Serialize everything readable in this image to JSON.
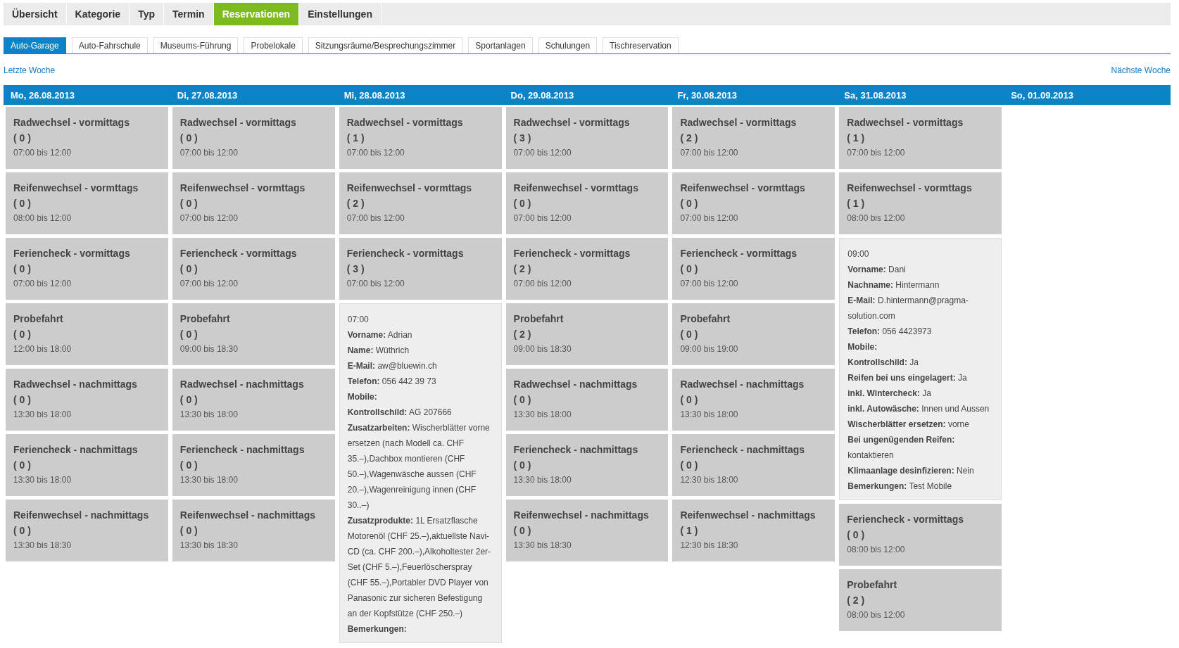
{
  "main_nav": [
    {
      "label": "Übersicht",
      "selected": false
    },
    {
      "label": "Kategorie",
      "selected": false
    },
    {
      "label": "Typ",
      "selected": false
    },
    {
      "label": "Termin",
      "selected": false
    },
    {
      "label": "Reservationen",
      "selected": true
    },
    {
      "label": "Einstellungen",
      "selected": false
    }
  ],
  "sub_tabs": [
    {
      "label": "Auto-Garage",
      "selected": true
    },
    {
      "label": "Auto-Fahrschule",
      "selected": false
    },
    {
      "label": "Museums-Führung",
      "selected": false
    },
    {
      "label": "Probelokale",
      "selected": false
    },
    {
      "label": "Sitzungsräume/Besprechungszimmer",
      "selected": false
    },
    {
      "label": "Sportanlagen",
      "selected": false
    },
    {
      "label": "Schulungen",
      "selected": false
    },
    {
      "label": "Tischreservation",
      "selected": false
    }
  ],
  "week_nav": {
    "previous": "Letzte Woche",
    "next": "Nächste Woche"
  },
  "days": [
    {
      "date": "Mo, 26.08.2013",
      "entries": [
        {
          "kind": "slot",
          "title": "Radwechsel - vormittags",
          "count": "( 0 )",
          "time": "07:00 bis 12:00"
        },
        {
          "kind": "slot",
          "title": "Reifenwechsel - vormttags",
          "count": "( 0 )",
          "time": "08:00 bis 12:00"
        },
        {
          "kind": "slot",
          "title": "Feriencheck - vormittags",
          "count": "( 0 )",
          "time": "07:00 bis 12:00"
        },
        {
          "kind": "slot",
          "title": "Probefahrt",
          "count": "( 0 )",
          "time": "12:00 bis 18:00"
        },
        {
          "kind": "slot",
          "title": "Radwechsel - nachmittags",
          "count": "( 0 )",
          "time": "13:30 bis 18:00"
        },
        {
          "kind": "slot",
          "title": "Feriencheck - nachmittags",
          "count": "( 0 )",
          "time": "13:30 bis 18:00"
        },
        {
          "kind": "slot",
          "title": "Reifenwechsel - nachmittags",
          "count": "( 0 )",
          "time": "13:30 bis 18:30"
        }
      ]
    },
    {
      "date": "Di, 27.08.2013",
      "entries": [
        {
          "kind": "slot",
          "title": "Radwechsel - vormittags",
          "count": "( 0 )",
          "time": "07:00 bis 12:00"
        },
        {
          "kind": "slot",
          "title": "Reifenwechsel - vormttags",
          "count": "( 0 )",
          "time": "07:00 bis 12:00"
        },
        {
          "kind": "slot",
          "title": "Feriencheck - vormittags",
          "count": "( 0 )",
          "time": "07:00 bis 12:00"
        },
        {
          "kind": "slot",
          "title": "Probefahrt",
          "count": "( 0 )",
          "time": "09:00 bis 18:30"
        },
        {
          "kind": "slot",
          "title": "Radwechsel - nachmittags",
          "count": "( 0 )",
          "time": "13:30 bis 18:00"
        },
        {
          "kind": "slot",
          "title": "Feriencheck - nachmittags",
          "count": "( 0 )",
          "time": "13:30 bis 18:00"
        },
        {
          "kind": "slot",
          "title": "Reifenwechsel - nachmittags",
          "count": "( 0 )",
          "time": "13:30 bis 18:30"
        }
      ]
    },
    {
      "date": "Mi, 28.08.2013",
      "entries": [
        {
          "kind": "slot",
          "title": "Radwechsel - vormittags",
          "count": "( 1 )",
          "time": "07:00 bis 12:00"
        },
        {
          "kind": "slot",
          "title": "Reifenwechsel - vormttags",
          "count": "( 2 )",
          "time": "07:00 bis 12:00"
        },
        {
          "kind": "slot",
          "title": "Feriencheck - vormittags",
          "count": "( 3 )",
          "time": "07:00 bis 12:00"
        },
        {
          "kind": "detail",
          "time": "07:00",
          "fields": [
            {
              "label": "Vorname:",
              "value": "Adrian"
            },
            {
              "label": "Name:",
              "value": "Wüthrich"
            },
            {
              "label": "E-Mail:",
              "value": "aw@bluewin.ch"
            },
            {
              "label": "Telefon:",
              "value": "056 442 39 73"
            },
            {
              "label": "Mobile:"
            },
            {
              "label": "Kontrollschild:",
              "value": "AG 207666"
            },
            {
              "label": "Zusatzarbeiten:",
              "value": "Wischerblätter vorne ersetzen (nach Modell ca. CHF 35.–),Dachbox montieren (CHF 50.–),Wagenwäsche aussen (CHF 20.–),Wagenreinigung innen (CHF 30..–)"
            },
            {
              "label": "Zusatzprodukte:",
              "value": "1L Ersatzflasche Motorenöl (CHF 25.–),aktuellste Navi-CD (ca. CHF 200.–),Alkoholtester 2er-Set (CHF 5.–),Feuerlöscherspray (CHF 55.–),Portabler DVD Player von Panasonic zur sicheren Befestigung an der Kopfstütze (CHF 250.–)"
            },
            {
              "label": "Bemerkungen:"
            }
          ]
        }
      ]
    },
    {
      "date": "Do, 29.08.2013",
      "entries": [
        {
          "kind": "slot",
          "title": "Radwechsel - vormittags",
          "count": "( 3 )",
          "time": "07:00 bis 12:00"
        },
        {
          "kind": "slot",
          "title": "Reifenwechsel - vormttags",
          "count": "( 0 )",
          "time": "07:00 bis 12:00"
        },
        {
          "kind": "slot",
          "title": "Feriencheck - vormittags",
          "count": "( 2 )",
          "time": "07:00 bis 12:00"
        },
        {
          "kind": "slot",
          "title": "Probefahrt",
          "count": "( 2 )",
          "time": "09:00 bis 18:30"
        },
        {
          "kind": "slot",
          "title": "Radwechsel - nachmittags",
          "count": "( 0 )",
          "time": "13:30 bis 18:00"
        },
        {
          "kind": "slot",
          "title": "Feriencheck - nachmittags",
          "count": "( 0 )",
          "time": "13:30 bis 18:00"
        },
        {
          "kind": "slot",
          "title": "Reifenwechsel - nachmittags",
          "count": "( 0 )",
          "time": "13:30 bis 18:30"
        }
      ]
    },
    {
      "date": "Fr, 30.08.2013",
      "entries": [
        {
          "kind": "slot",
          "title": "Radwechsel - vormittags",
          "count": "( 2 )",
          "time": "07:00 bis 12:00"
        },
        {
          "kind": "slot",
          "title": "Reifenwechsel - vormttags",
          "count": "( 0 )",
          "time": "07:00 bis 12:00"
        },
        {
          "kind": "slot",
          "title": "Feriencheck - vormittags",
          "count": "( 0 )",
          "time": "07:00 bis 12:00"
        },
        {
          "kind": "slot",
          "title": "Probefahrt",
          "count": "( 0 )",
          "time": "09:00 bis 19:00"
        },
        {
          "kind": "slot",
          "title": "Radwechsel - nachmittags",
          "count": "( 0 )",
          "time": "13:30 bis 18:00"
        },
        {
          "kind": "slot",
          "title": "Feriencheck - nachmittags",
          "count": "( 0 )",
          "time": "12:30 bis 18:00"
        },
        {
          "kind": "slot",
          "title": "Reifenwechsel - nachmittags",
          "count": "( 1 )",
          "time": "12:30 bis 18:30"
        }
      ]
    },
    {
      "date": "Sa, 31.08.2013",
      "entries": [
        {
          "kind": "slot",
          "title": "Radwechsel - vormittags",
          "count": "( 1 )",
          "time": "07:00 bis 12:00"
        },
        {
          "kind": "slot",
          "title": "Reifenwechsel - vormttags",
          "count": "( 1 )",
          "time": "08:00 bis 12:00"
        },
        {
          "kind": "detail",
          "time": "09:00",
          "fields": [
            {
              "label": "Vorname:",
              "value": "Dani"
            },
            {
              "label": "Nachname:",
              "value": "Hintermann"
            },
            {
              "label": "E-Mail:",
              "value": "D.hintermann@pragma-solution.com"
            },
            {
              "label": "Telefon:",
              "value": "056 4423973"
            },
            {
              "label": "Mobile:"
            },
            {
              "label": "Kontrollschild:",
              "value": "Ja"
            },
            {
              "label": "Reifen bei uns eingelagert:",
              "value": "Ja"
            },
            {
              "label": "inkl. Wintercheck:",
              "value": "Ja"
            },
            {
              "label": "inkl. Autowäsche:",
              "value": "Innen und Aussen"
            },
            {
              "label": "Wischerblätter ersetzen:",
              "value": "vorne"
            },
            {
              "label": "Bei ungenügenden Reifen:",
              "value": "kontaktieren"
            },
            {
              "label": "Klimaanlage desinfizieren:",
              "value": "Nein"
            },
            {
              "label": "Bemerkungen:",
              "value": "Test Mobile"
            }
          ]
        },
        {
          "kind": "slot",
          "title": "Feriencheck - vormittags",
          "count": "( 0 )",
          "time": "08:00 bis 12:00"
        },
        {
          "kind": "slot",
          "title": "Probefahrt",
          "count": "( 2 )",
          "time": "08:00 bis 12:00"
        }
      ]
    },
    {
      "date": "So, 01.09.2013"
    }
  ]
}
